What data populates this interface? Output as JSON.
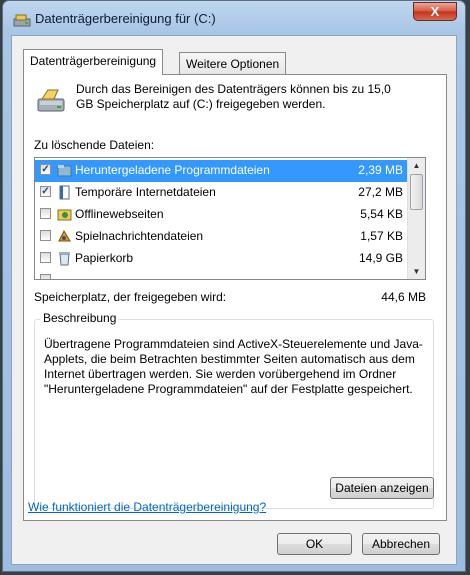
{
  "window": {
    "title": "Datenträgerbereinigung für  (C:)",
    "close_label": "X"
  },
  "tabs": [
    {
      "label": "Datenträgerbereinigung",
      "active": true
    },
    {
      "label": "Weitere Optionen",
      "active": false
    }
  ],
  "intro": {
    "icon": "disk-cleanup-icon",
    "text": "Durch das Bereinigen des Datenträgers können bis zu 15,0 GB Speicherplatz auf  (C:) freigegeben werden."
  },
  "file_list": {
    "label": "Zu löschende Dateien:",
    "items": [
      {
        "name": "Heruntergeladene Programmdateien",
        "size": "2,39 MB",
        "checked": true,
        "selected": true,
        "icon": "folder-icon"
      },
      {
        "name": "Temporäre Internetdateien",
        "size": "27,2 MB",
        "checked": true,
        "selected": false,
        "icon": "document-icon"
      },
      {
        "name": "Offlinewebseiten",
        "size": "5,54 KB",
        "checked": false,
        "selected": false,
        "icon": "offline-folder-icon"
      },
      {
        "name": "Spielnachrichtendateien",
        "size": "1,57 KB",
        "checked": false,
        "selected": false,
        "icon": "game-icon"
      },
      {
        "name": "Papierkorb",
        "size": "14,9 GB",
        "checked": false,
        "selected": false,
        "icon": "recycle-bin-icon"
      }
    ]
  },
  "space": {
    "label": "Speicherplatz, der freigegeben wird:",
    "value": "44,6 MB"
  },
  "description": {
    "title": "Beschreibung",
    "text": "Übertragene Programmdateien sind ActiveX-Steuerelemente und Java-Applets, die beim Betrachten bestimmter Seiten automatisch aus dem Internet übertragen werden. Sie werden vorübergehend im Ordner \"Heruntergeladene Programmdateien\" auf der Festplatte gespeichert.",
    "view_files_label": "Dateien anzeigen"
  },
  "help_link": "Wie funktioniert die Datenträgerbereinigung?",
  "buttons": {
    "ok": "OK",
    "cancel": "Abbrechen"
  },
  "colors": {
    "selection": "#3399ff",
    "link": "#0066cc",
    "close_button": "#c7381d"
  }
}
